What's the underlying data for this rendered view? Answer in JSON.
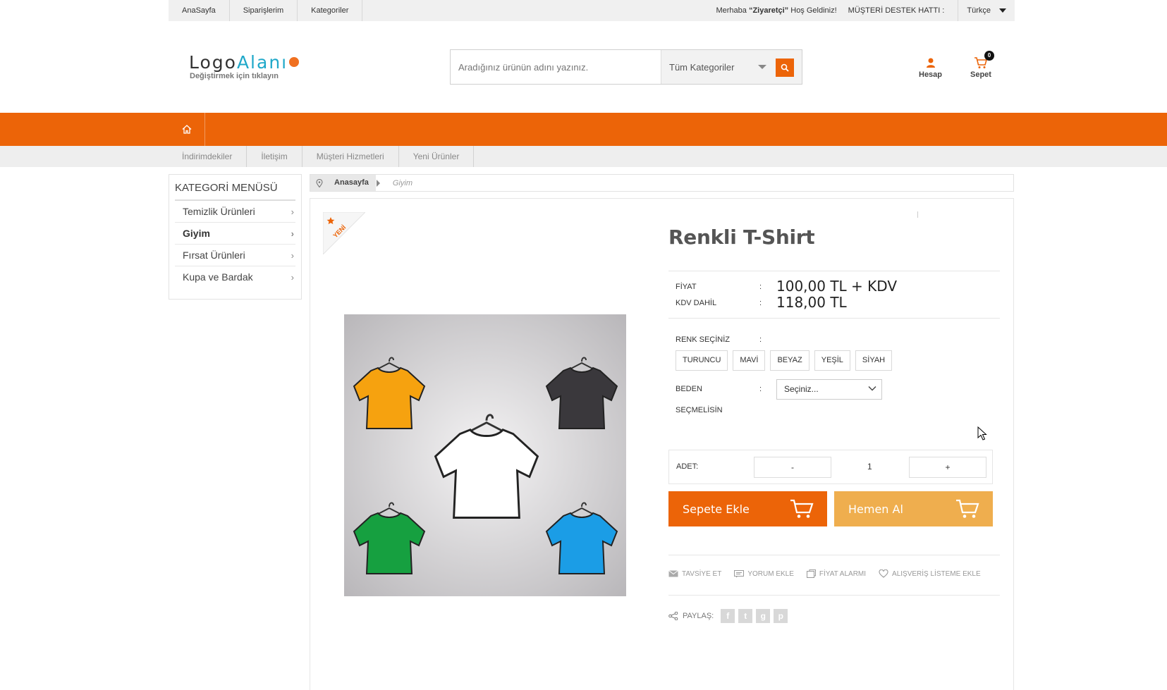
{
  "topbar": {
    "nav": [
      "AnaSayfa",
      "Siparişlerim",
      "Kategoriler"
    ],
    "welcome_prefix": "Merhaba",
    "welcome_user": "“Ziyaretçi”",
    "welcome_suffix": "Hoş Geldiniz!",
    "support": "MÜŞTERİ DESTEK HATTI :",
    "language": "Türkçe"
  },
  "logo": {
    "part1": "Logo",
    "part2": "Alanı",
    "subtitle": "Değiştirmek için tıklayın"
  },
  "search": {
    "placeholder": "Aradığınız ürünün adını yazınız.",
    "category": "Tüm Kategoriler"
  },
  "header": {
    "account_label": "Hesap",
    "cart_label": "Sepet",
    "cart_count": "0"
  },
  "subnav": [
    "İndirimdekiler",
    "İletişim",
    "Müşteri Hizmetleri",
    "Yeni Ürünler"
  ],
  "sidebar": {
    "title": "KATEGORİ MENÜSÜ",
    "items": [
      {
        "label": "Temizlik Ürünleri",
        "active": false
      },
      {
        "label": "Giyim",
        "active": true
      },
      {
        "label": "Fırsat Ürünleri",
        "active": false
      },
      {
        "label": "Kupa ve Bardak",
        "active": false
      }
    ]
  },
  "breadcrumb": {
    "home": "Anasayfa",
    "current": "Giyim"
  },
  "product": {
    "badge": "YENİ",
    "title": "Renkli T-Shirt",
    "price_label": "FİYAT",
    "price_value": "100,00 TL + KDV",
    "vat_label": "KDV DAHİL",
    "vat_value": "118,00 TL",
    "colon": ":",
    "color_label": "RENK SEÇİNİZ",
    "colors": [
      "TURUNCU",
      "MAVİ",
      "BEYAZ",
      "YEŞİL",
      "SİYAH"
    ],
    "size_label": "BEDEN",
    "size_placeholder": "Seçiniz...",
    "required_note": "SEÇMELİSİN",
    "qty_label": "ADET:",
    "qty_minus": "-",
    "qty_value": "1",
    "qty_plus": "+",
    "add_to_cart": "Sepete Ekle",
    "buy_now": "Hemen Al",
    "actions": [
      "TAVSİYE ET",
      "YORUM EKLE",
      "FİYAT ALARMI",
      "ALIŞVERİŞ LİSTEME EKLE"
    ],
    "share_label": "PAYLAŞ:"
  },
  "colors": {
    "accent": "#ec6408",
    "accent_light": "#efae4e"
  }
}
